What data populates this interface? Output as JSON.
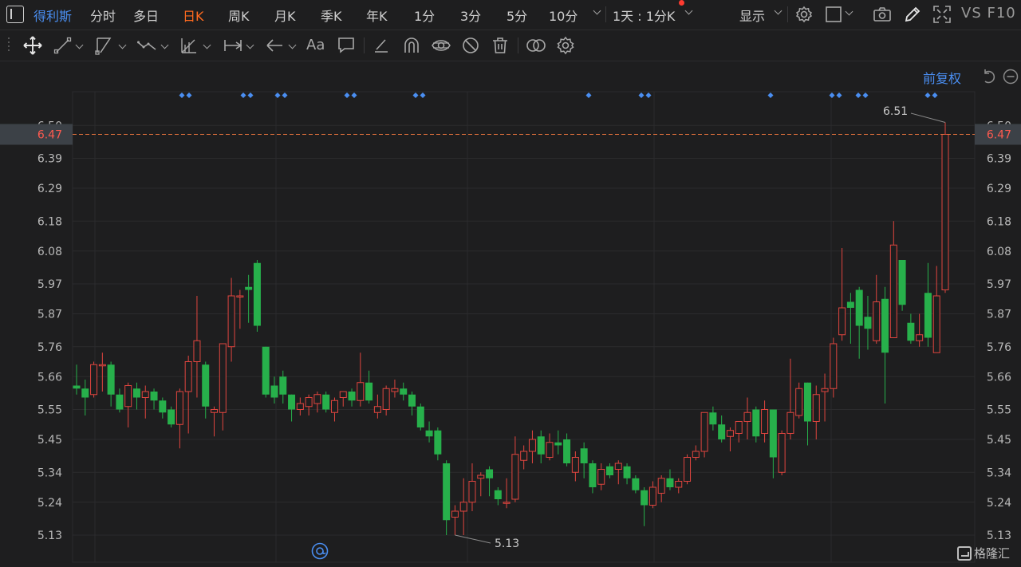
{
  "topbar": {
    "stock_name": "得利斯",
    "periods": [
      "分时",
      "多日",
      "日K",
      "周K",
      "月K",
      "季K",
      "年K",
      "1分",
      "3分",
      "5分",
      "10分"
    ],
    "active_period": "日K",
    "multi_day": "1天 : 1分K",
    "display": "显示",
    "vs_f10": "VS F10",
    "icons": [
      "sidebar-toggle-icon",
      "settings-icon",
      "checkbox-icon",
      "camera-icon",
      "pencil-icon",
      "fullscreen-icon"
    ]
  },
  "drawbar": {
    "tools": [
      "move-icon",
      "line-icon",
      "channel-icon",
      "wave-icon",
      "fibonacci-icon",
      "measure-icon",
      "arrow-icon",
      "text-icon",
      "comment-icon",
      "eraser-icon",
      "magnet-icon",
      "eye-toggle-icon",
      "hide-icon",
      "trash-icon",
      "compare-icon",
      "gear-icon"
    ],
    "text_tool_label": "Aa"
  },
  "chart": {
    "adjust_label": "前复权",
    "current_price": "6.47",
    "high_label": "6.51",
    "low_label": "5.13",
    "watermark": "格隆汇",
    "colors": {
      "up": "#e0453f",
      "down": "#27b04b",
      "price_line": "#e0703c",
      "label_bg": "#3c4147",
      "marker": "#4a8ef1"
    }
  },
  "chart_data": {
    "type": "candlestick",
    "y_ticks": [
      "6.50",
      "6.39",
      "6.29",
      "6.18",
      "6.08",
      "5.97",
      "5.87",
      "5.76",
      "5.66",
      "5.55",
      "5.45",
      "5.34",
      "5.24",
      "5.13"
    ],
    "ylim": [
      5.08,
      6.55
    ],
    "max_point": 6.51,
    "min_point": 5.13,
    "last_price": 6.47,
    "event_marker_groups": [
      2,
      2,
      2,
      2,
      2,
      1,
      2,
      1,
      2,
      2,
      2
    ],
    "candles": [
      [
        5.63,
        5.62,
        5.7,
        5.6
      ],
      [
        5.62,
        5.59,
        5.65,
        5.53
      ],
      [
        5.6,
        5.7,
        5.71,
        5.59
      ],
      [
        5.7,
        5.7,
        5.74,
        5.61
      ],
      [
        5.7,
        5.6,
        5.71,
        5.56
      ],
      [
        5.6,
        5.55,
        5.62,
        5.54
      ],
      [
        5.56,
        5.63,
        5.64,
        5.49
      ],
      [
        5.62,
        5.59,
        5.64,
        5.55
      ],
      [
        5.59,
        5.61,
        5.63,
        5.52
      ],
      [
        5.61,
        5.58,
        5.62,
        5.55
      ],
      [
        5.58,
        5.54,
        5.59,
        5.52
      ],
      [
        5.55,
        5.5,
        5.56,
        5.49
      ],
      [
        5.5,
        5.61,
        5.62,
        5.42
      ],
      [
        5.61,
        5.71,
        5.73,
        5.47
      ],
      [
        5.71,
        5.78,
        5.93,
        5.59
      ],
      [
        5.7,
        5.56,
        5.71,
        5.52
      ],
      [
        5.54,
        5.55,
        5.56,
        5.46
      ],
      [
        5.54,
        5.77,
        5.77,
        5.48
      ],
      [
        5.76,
        5.93,
        5.99,
        5.71
      ],
      [
        5.93,
        5.93,
        5.95,
        5.82
      ],
      [
        5.96,
        5.95,
        6.0,
        5.84
      ],
      [
        6.04,
        5.83,
        6.05,
        5.81
      ],
      [
        5.76,
        5.6,
        5.76,
        5.59
      ],
      [
        5.63,
        5.59,
        5.66,
        5.57
      ],
      [
        5.66,
        5.6,
        5.68,
        5.57
      ],
      [
        5.6,
        5.55,
        5.6,
        5.51
      ],
      [
        5.55,
        5.57,
        5.59,
        5.53
      ],
      [
        5.56,
        5.59,
        5.6,
        5.53
      ],
      [
        5.57,
        5.6,
        5.61,
        5.54
      ],
      [
        5.6,
        5.55,
        5.61,
        5.54
      ],
      [
        5.54,
        5.58,
        5.59,
        5.51
      ],
      [
        5.59,
        5.61,
        5.61,
        5.56
      ],
      [
        5.61,
        5.58,
        5.62,
        5.56
      ],
      [
        5.58,
        5.64,
        5.74,
        5.56
      ],
      [
        5.64,
        5.58,
        5.68,
        5.57
      ],
      [
        5.54,
        5.56,
        5.6,
        5.52
      ],
      [
        5.55,
        5.62,
        5.63,
        5.53
      ],
      [
        5.61,
        5.62,
        5.65,
        5.59
      ],
      [
        5.62,
        5.6,
        5.64,
        5.58
      ],
      [
        5.6,
        5.56,
        5.61,
        5.53
      ],
      [
        5.56,
        5.49,
        5.57,
        5.48
      ],
      [
        5.48,
        5.46,
        5.51,
        5.44
      ],
      [
        5.48,
        5.4,
        5.49,
        5.38
      ],
      [
        5.37,
        5.18,
        5.38,
        5.13
      ],
      [
        5.19,
        5.21,
        5.23,
        5.13
      ],
      [
        5.21,
        5.24,
        5.32,
        5.13
      ],
      [
        5.24,
        5.31,
        5.37,
        5.21
      ],
      [
        5.32,
        5.33,
        5.34,
        5.26
      ],
      [
        5.35,
        5.32,
        5.36,
        5.26
      ],
      [
        5.28,
        5.25,
        5.29,
        5.23
      ],
      [
        5.24,
        5.24,
        5.32,
        5.22
      ],
      [
        5.25,
        5.4,
        5.46,
        5.24
      ],
      [
        5.38,
        5.41,
        5.43,
        5.35
      ],
      [
        5.41,
        5.45,
        5.48,
        5.37
      ],
      [
        5.46,
        5.4,
        5.48,
        5.37
      ],
      [
        5.39,
        5.44,
        5.47,
        5.38
      ],
      [
        5.44,
        5.43,
        5.48,
        5.4
      ],
      [
        5.45,
        5.37,
        5.47,
        5.36
      ],
      [
        5.34,
        5.39,
        5.41,
        5.31
      ],
      [
        5.42,
        5.37,
        5.44,
        5.32
      ],
      [
        5.37,
        5.29,
        5.38,
        5.27
      ],
      [
        5.3,
        5.35,
        5.37,
        5.28
      ],
      [
        5.36,
        5.33,
        5.37,
        5.32
      ],
      [
        5.35,
        5.37,
        5.38,
        5.3
      ],
      [
        5.36,
        5.32,
        5.37,
        5.3
      ],
      [
        5.32,
        5.28,
        5.33,
        5.27
      ],
      [
        5.28,
        5.23,
        5.29,
        5.16
      ],
      [
        5.23,
        5.29,
        5.31,
        5.22
      ],
      [
        5.27,
        5.32,
        5.33,
        5.24
      ],
      [
        5.32,
        5.29,
        5.35,
        5.28
      ],
      [
        5.29,
        5.31,
        5.32,
        5.27
      ],
      [
        5.31,
        5.39,
        5.4,
        5.3
      ],
      [
        5.39,
        5.41,
        5.43,
        5.38
      ],
      [
        5.41,
        5.54,
        5.54,
        5.39
      ],
      [
        5.54,
        5.5,
        5.56,
        5.48
      ],
      [
        5.5,
        5.45,
        5.53,
        5.44
      ],
      [
        5.46,
        5.48,
        5.49,
        5.41
      ],
      [
        5.47,
        5.51,
        5.51,
        5.44
      ],
      [
        5.51,
        5.54,
        5.59,
        5.45
      ],
      [
        5.55,
        5.46,
        5.56,
        5.44
      ],
      [
        5.47,
        5.55,
        5.58,
        5.44
      ],
      [
        5.55,
        5.39,
        5.55,
        5.32
      ],
      [
        5.34,
        5.47,
        5.48,
        5.33
      ],
      [
        5.47,
        5.54,
        5.72,
        5.45
      ],
      [
        5.53,
        5.62,
        5.64,
        5.52
      ],
      [
        5.64,
        5.51,
        5.64,
        5.43
      ],
      [
        5.51,
        5.6,
        5.63,
        5.45
      ],
      [
        5.61,
        5.62,
        5.67,
        5.51
      ],
      [
        5.62,
        5.77,
        5.79,
        5.59
      ],
      [
        5.8,
        5.89,
        6.09,
        5.78
      ],
      [
        5.91,
        5.89,
        5.94,
        5.77
      ],
      [
        5.95,
        5.83,
        5.96,
        5.72
      ],
      [
        5.86,
        5.82,
        5.93,
        5.75
      ],
      [
        5.78,
        5.91,
        6.0,
        5.77
      ],
      [
        5.92,
        5.74,
        5.96,
        5.57
      ],
      [
        5.79,
        6.1,
        6.18,
        5.79
      ],
      [
        6.05,
        5.9,
        6.05,
        5.88
      ],
      [
        5.84,
        5.78,
        5.87,
        5.77
      ],
      [
        5.78,
        5.8,
        5.87,
        5.76
      ],
      [
        5.94,
        5.79,
        6.04,
        5.76
      ],
      [
        5.74,
        5.93,
        6.03,
        5.74
      ],
      [
        5.95,
        6.47,
        6.51,
        5.94
      ]
    ]
  }
}
